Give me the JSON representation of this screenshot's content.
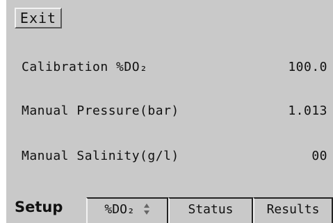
{
  "toolbar": {
    "exit_label": "Exit"
  },
  "settings": [
    {
      "label": "Calibration %DO₂",
      "value": "100.0"
    },
    {
      "label": "Manual Pressure(bar)",
      "value": "1.013"
    },
    {
      "label": "Manual Salinity(g/l)",
      "value": "00"
    }
  ],
  "tabs": [
    {
      "label": "Setup",
      "active": true
    },
    {
      "label": "%DO₂",
      "active": false
    },
    {
      "label": "Status",
      "active": false
    },
    {
      "label": "Results",
      "active": false
    }
  ],
  "icons": {
    "do2_tab_icon": "up-down-arrows-icon"
  },
  "colors": {
    "background": "#c9c9c9",
    "text": "#111111"
  }
}
